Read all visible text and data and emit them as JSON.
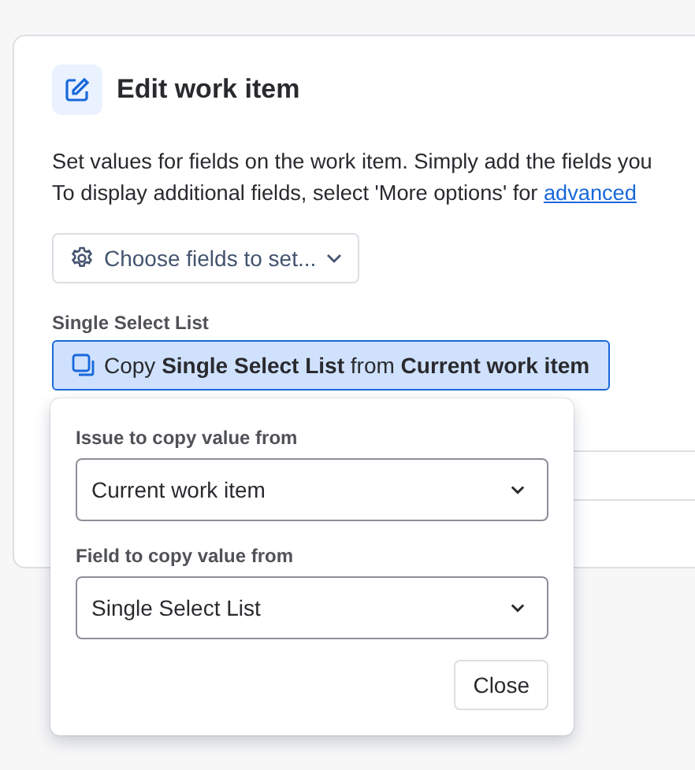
{
  "card": {
    "title": "Edit work item",
    "description": [
      "Set values for fields on the work item. Simply add the fields you",
      "To display additional fields, select 'More options' for "
    ],
    "link": "advanced",
    "choose_button": "Choose fields to set...",
    "field_label": "Single Select List",
    "copy_button": "Copy **Single Select List** from **Current work item**",
    "copy_selected": true
  },
  "popup": {
    "fields": [
      {
        "label": "Issue to copy value from",
        "value": "Current work item"
      },
      {
        "label": "Field to copy value from",
        "value": "Single Select List"
      }
    ],
    "close_button": "Close"
  }
}
